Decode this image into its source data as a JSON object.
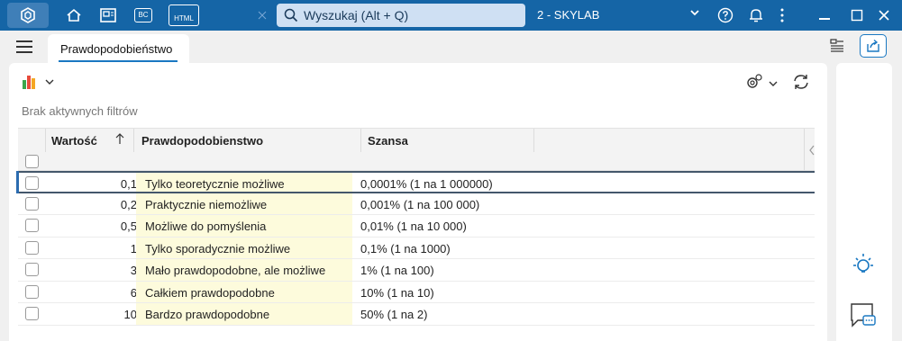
{
  "titlebar": {
    "search_placeholder": "Wyszukaj (Alt + Q)",
    "company": "2 - SKYLAB",
    "icons": [
      "app-logo-icon",
      "home-icon",
      "window-icon",
      "bc-icon",
      "html-icon",
      "search-icon",
      "chevron-down-icon",
      "help-icon",
      "bell-icon",
      "more-icon",
      "minimize-icon",
      "maximize-icon",
      "close-icon"
    ],
    "bc_text": "BC",
    "html_text": "HTML"
  },
  "tab": {
    "label": "Prawdopodobieństwo"
  },
  "toolbar": {
    "filters_text": "Brak aktywnych filtrów"
  },
  "grid": {
    "columns": [
      "Wartość",
      "Prawdopodobienstwo",
      "Szansa"
    ],
    "rows": [
      {
        "wartosc": "0,1",
        "prawdopodobienstwo": "Tylko teoretycznie możliwe",
        "szansa": "0,0001% (1 na 1 000000)"
      },
      {
        "wartosc": "0,2",
        "prawdopodobienstwo": "Praktycznie niemożliwe",
        "szansa": "0,001% (1 na 100 000)"
      },
      {
        "wartosc": "0,5",
        "prawdopodobienstwo": "Możliwe do pomyślenia",
        "szansa": "0,01% (1 na 10 000)"
      },
      {
        "wartosc": "1",
        "prawdopodobienstwo": "Tylko sporadycznie możliwe",
        "szansa": "0,1% (1 na 1000)"
      },
      {
        "wartosc": "3",
        "prawdopodobienstwo": "Mało prawdopodobne, ale możliwe",
        "szansa": "1% (1 na 100)"
      },
      {
        "wartosc": "6",
        "prawdopodobienstwo": "Całkiem prawdopodobne",
        "szansa": "10% (1 na 10)"
      },
      {
        "wartosc": "10",
        "prawdopodobienstwo": "Bardzo prawdopodobne",
        "szansa": "50% (1 na 2)"
      }
    ]
  },
  "colors": {
    "titlebar": "#1565a6",
    "highlight_column": "#fdfbdc",
    "accent": "#1a78c2"
  }
}
